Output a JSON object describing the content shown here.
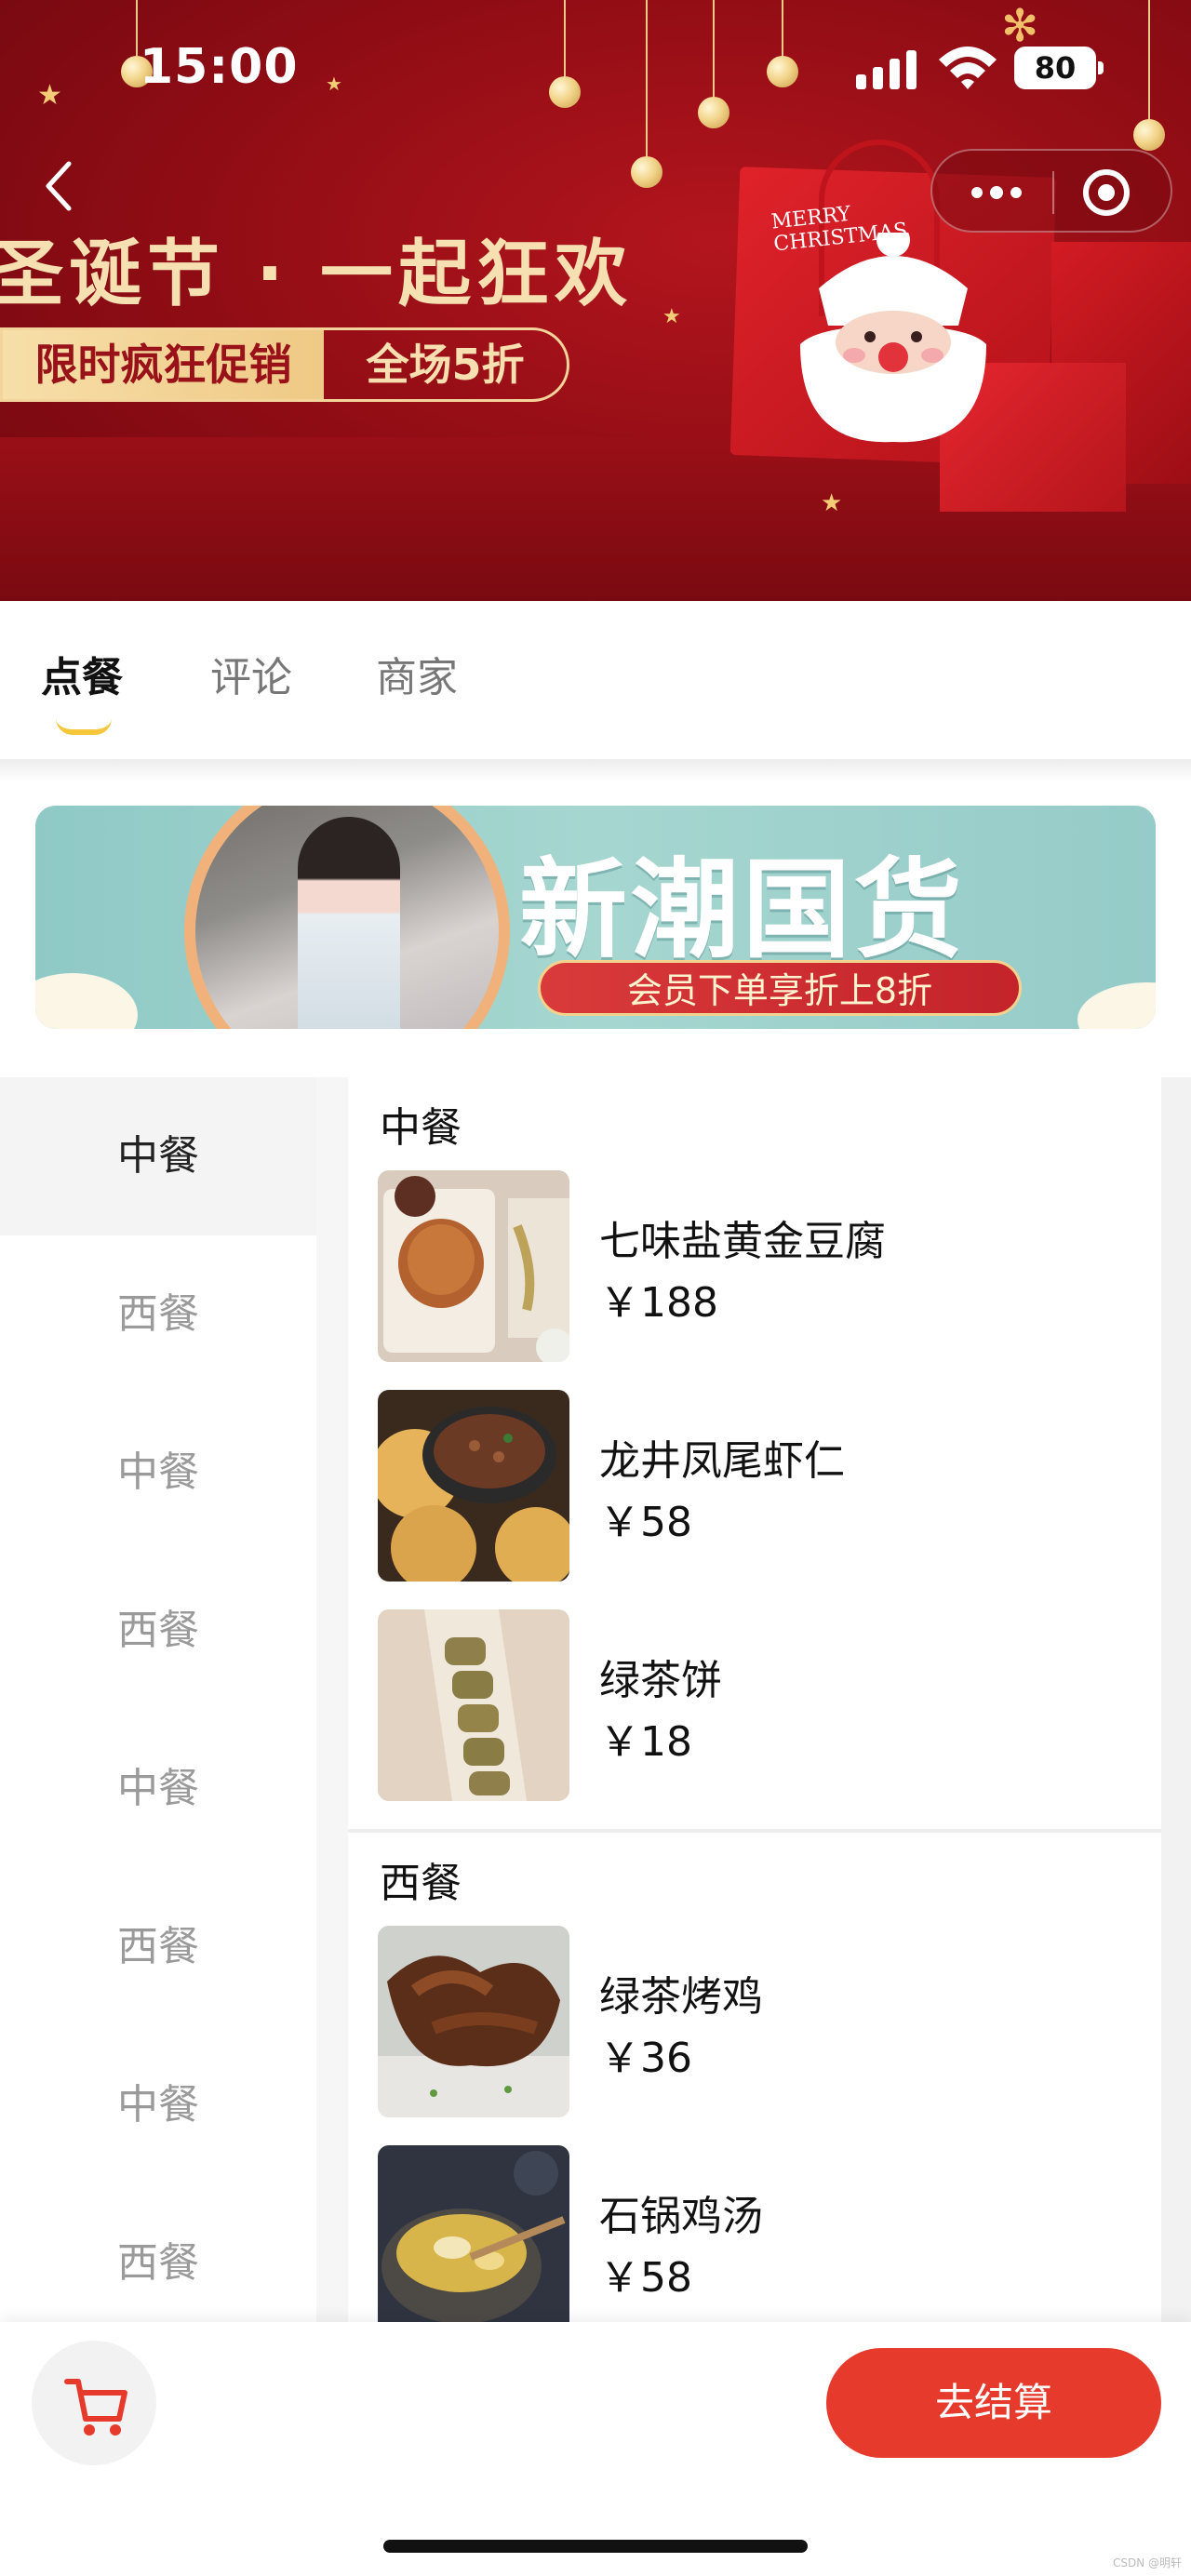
{
  "status_bar": {
    "time": "15:00",
    "battery": "80"
  },
  "banner": {
    "title": "圣诞节 · 一起狂欢",
    "promo_left": "限时疯狂促销",
    "promo_right": "全场5折",
    "box_text_1": "MERRY",
    "box_text_2": "CHRISTMAS"
  },
  "tabs": [
    {
      "label": "点餐",
      "active": true
    },
    {
      "label": "评论",
      "active": false
    },
    {
      "label": "商家",
      "active": false
    }
  ],
  "ad": {
    "title": "新潮国货",
    "subtitle": "会员下单享折上8折"
  },
  "sidebar": {
    "items": [
      {
        "label": "中餐",
        "active": true
      },
      {
        "label": "西餐"
      },
      {
        "label": "中餐"
      },
      {
        "label": "西餐"
      },
      {
        "label": "中餐"
      },
      {
        "label": "西餐"
      },
      {
        "label": "中餐"
      },
      {
        "label": "西餐"
      }
    ]
  },
  "menu": {
    "groups": [
      {
        "title": "中餐",
        "dishes": [
          {
            "name": "七味盐黄金豆腐",
            "price": "￥188"
          },
          {
            "name": "龙井凤尾虾仁",
            "price": "￥58"
          },
          {
            "name": "绿茶饼",
            "price": "￥18"
          }
        ]
      },
      {
        "title": "西餐",
        "dishes": [
          {
            "name": "绿茶烤鸡",
            "price": "￥36"
          },
          {
            "name": "石锅鸡汤",
            "price": "￥58"
          }
        ]
      }
    ]
  },
  "bottom_bar": {
    "checkout_label": "去结算"
  },
  "watermark": "CSDN @明轩",
  "colors": {
    "accent": "#e63a2c",
    "tab_indicator": "#f4c83a",
    "banner": "#9a0f17"
  },
  "icons": [
    "back-icon",
    "more-icon",
    "close-circle-icon",
    "cart-icon",
    "signal-icon",
    "wifi-icon",
    "battery-icon"
  ]
}
